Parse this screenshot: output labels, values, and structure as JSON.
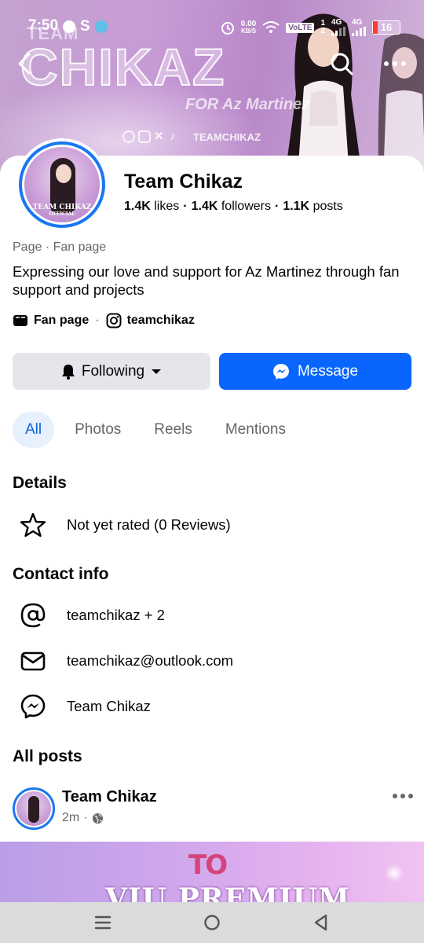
{
  "status_bar": {
    "time": "7:50",
    "net_speed_top": "0.00",
    "net_speed_bottom": "KB/S",
    "volte": "VoLTE",
    "sim_top": "1",
    "sim_bottom": "2",
    "network_1": "4G",
    "network_2": "4G",
    "battery": "16"
  },
  "cover": {
    "team_text": "TEAM",
    "title_text": "CHIKAZ",
    "for_text": "FOR Az Martinez",
    "social_handle": "TEAMCHIKAZ"
  },
  "avatar": {
    "label_line1": "TEAM CHIKAZ",
    "label_line2": "OFFICIAL"
  },
  "profile": {
    "name": "Team Chikaz",
    "likes_count": "1.4K",
    "likes_label": "likes",
    "followers_count": "1.4K",
    "followers_label": "followers",
    "posts_count": "1.1K",
    "posts_label": "posts",
    "category": "Page · Fan page",
    "bio": "Expressing our love and support for Az Martinez through fan support and projects",
    "meta_type": "Fan page",
    "meta_instagram": "teamchikaz"
  },
  "actions": {
    "following_label": "Following",
    "message_label": "Message"
  },
  "tabs": [
    {
      "label": "All",
      "active": true
    },
    {
      "label": "Photos",
      "active": false
    },
    {
      "label": "Reels",
      "active": false
    },
    {
      "label": "Mentions",
      "active": false
    }
  ],
  "details": {
    "title": "Details",
    "rating": "Not yet rated (0 Reviews)"
  },
  "contact": {
    "title": "Contact info",
    "username": "teamchikaz + 2",
    "email": "teamchikaz@outlook.com",
    "messenger": "Team Chikaz"
  },
  "posts": {
    "title": "All posts",
    "first": {
      "author": "Team Chikaz",
      "time": "2m",
      "image_logo": "TO",
      "image_headline": "VIU PREMIUM"
    }
  },
  "colors": {
    "accent": "#0866ff",
    "tab_active_bg": "#e7f0fd",
    "button_secondary": "#e4e6eb",
    "muted_text": "#65676b"
  }
}
